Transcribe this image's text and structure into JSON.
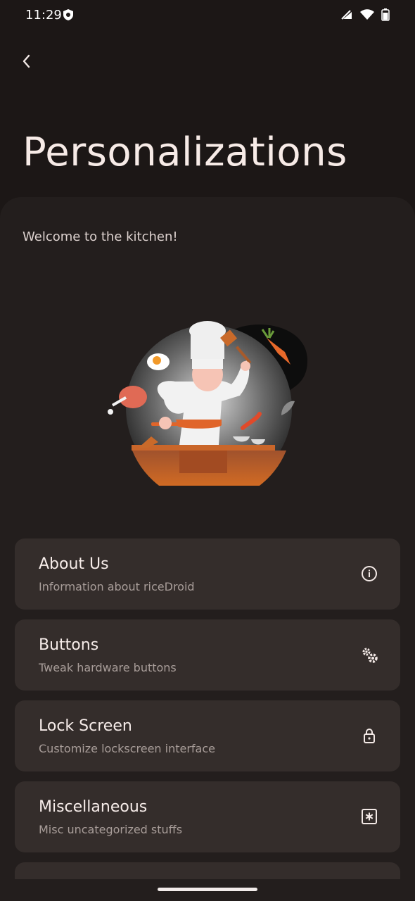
{
  "status_bar": {
    "time": "11:29"
  },
  "header": {
    "title": "Personalizations"
  },
  "welcome_text": "Welcome to the kitchen!",
  "cards": [
    {
      "title": "About Us",
      "subtitle": "Information about riceDroid",
      "icon": "info-icon"
    },
    {
      "title": "Buttons",
      "subtitle": "Tweak hardware buttons",
      "icon": "gears-icon"
    },
    {
      "title": "Lock Screen",
      "subtitle": "Customize lockscreen interface",
      "icon": "lock-icon"
    },
    {
      "title": "Miscellaneous",
      "subtitle": "Misc uncategorized stuffs",
      "icon": "asterisk-box-icon"
    }
  ],
  "colors": {
    "background": "#1c1716",
    "panel": "#231e1d",
    "card": "#342d2b",
    "accent": "#e06a2c"
  }
}
